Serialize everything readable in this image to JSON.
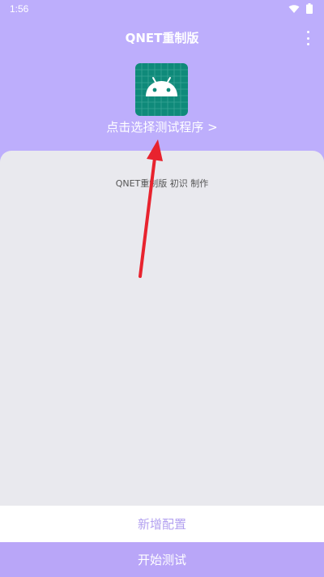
{
  "status_bar": {
    "time": "1:56",
    "icons": [
      "wifi-icon",
      "battery-icon"
    ]
  },
  "header": {
    "title": "QNET重制版",
    "menu_icon": "more-vert-icon",
    "app_icon": "android-icon",
    "select_program_label": "点击选择测试程序 >"
  },
  "main": {
    "credits": "QNET重制版 初识 制作"
  },
  "buttons": {
    "add_config": "新增配置",
    "start_test": "开始测试"
  },
  "colors": {
    "header_bg": "#bdaefc",
    "icon_bg": "#0f8a7a",
    "accent_text": "#b3a1f0",
    "start_button_bg": "#b9a6f8",
    "arrow": "#e8232e"
  }
}
